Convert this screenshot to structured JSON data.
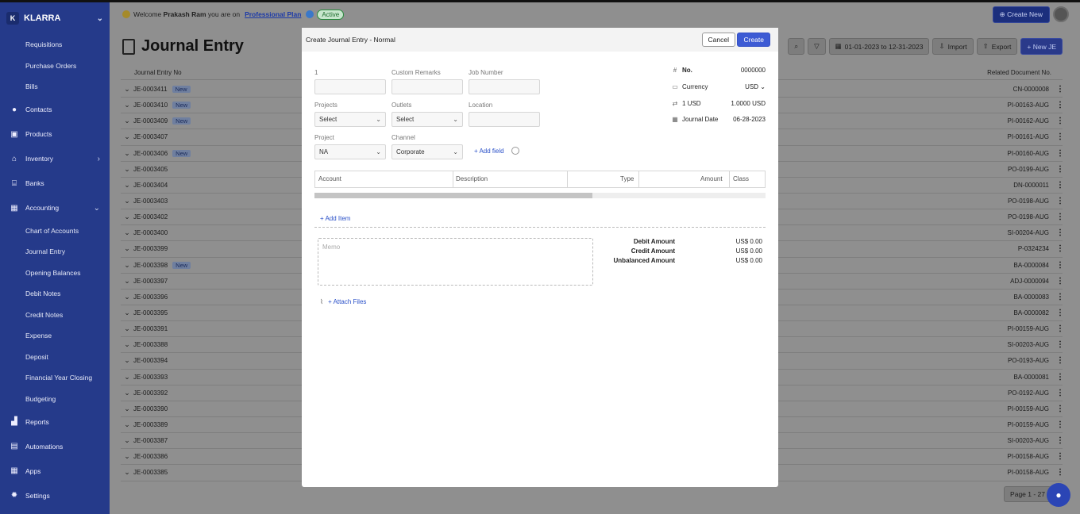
{
  "sidebar": {
    "brand_initial": "K",
    "brand": "KLARRA",
    "items": [
      {
        "type": "sub",
        "label": "Requisitions"
      },
      {
        "type": "sub",
        "label": "Purchase Orders"
      },
      {
        "type": "sub",
        "label": "Bills"
      },
      {
        "type": "main",
        "label": "Contacts",
        "icon": "user-icon"
      },
      {
        "type": "main",
        "label": "Products",
        "icon": "box-icon"
      },
      {
        "type": "main",
        "label": "Inventory",
        "icon": "home-icon",
        "chevron": "›"
      },
      {
        "type": "main",
        "label": "Banks",
        "icon": "bank-icon"
      },
      {
        "type": "main",
        "label": "Accounting",
        "icon": "grid-icon",
        "chevron": "⌄"
      },
      {
        "type": "sub",
        "label": "Chart of Accounts"
      },
      {
        "type": "sub",
        "label": "Journal Entry"
      },
      {
        "type": "sub",
        "label": "Opening Balances"
      },
      {
        "type": "sub",
        "label": "Debit Notes"
      },
      {
        "type": "sub",
        "label": "Credit Notes"
      },
      {
        "type": "sub",
        "label": "Expense"
      },
      {
        "type": "sub",
        "label": "Deposit"
      },
      {
        "type": "sub",
        "label": "Financial Year Closing"
      },
      {
        "type": "sub",
        "label": "Budgeting"
      },
      {
        "type": "main",
        "label": "Reports",
        "icon": "chart-icon"
      },
      {
        "type": "main",
        "label": "Automations",
        "icon": "robot-icon"
      },
      {
        "type": "main",
        "label": "Apps",
        "icon": "apps-icon"
      },
      {
        "type": "main",
        "label": "Settings",
        "icon": "gear-icon"
      }
    ]
  },
  "topbar": {
    "welcome": "Welcome",
    "user": "Prakash Ram",
    "you_are_on": "you are on",
    "plan": "Professional Plan",
    "status": "Active",
    "create_new": "Create New"
  },
  "page": {
    "title": "Journal Entry",
    "date_range": "01-01-2023 to 12-31-2023",
    "import": "Import",
    "export": "Export",
    "new_je": "+ New JE",
    "col_no": "Journal Entry No",
    "col_related": "Related Document No.",
    "pager": "Page 1 - 27"
  },
  "rows": [
    {
      "no": "JE-0003411",
      "new": "New",
      "rel": "CN-0000008"
    },
    {
      "no": "JE-0003410",
      "new": "New",
      "rel": "PI-00163-AUG"
    },
    {
      "no": "JE-0003409",
      "new": "New",
      "rel": "PI-00162-AUG"
    },
    {
      "no": "JE-0003407",
      "new": "",
      "rel": "PI-00161-AUG"
    },
    {
      "no": "JE-0003406",
      "new": "New",
      "rel": "PI-00160-AUG"
    },
    {
      "no": "JE-0003405",
      "new": "",
      "rel": "PO-0199-AUG"
    },
    {
      "no": "JE-0003404",
      "new": "",
      "rel": "DN-0000011"
    },
    {
      "no": "JE-0003403",
      "new": "",
      "rel": "PO-0198-AUG"
    },
    {
      "no": "JE-0003402",
      "new": "",
      "rel": "PO-0198-AUG"
    },
    {
      "no": "JE-0003400",
      "new": "",
      "rel": "SI-00204-AUG"
    },
    {
      "no": "JE-0003399",
      "new": "",
      "rel": "P-0324234"
    },
    {
      "no": "JE-0003398",
      "new": "New",
      "rel": "BA-0000084"
    },
    {
      "no": "JE-0003397",
      "new": "",
      "rel": "ADJ-0000094"
    },
    {
      "no": "JE-0003396",
      "new": "",
      "rel": "BA-0000083"
    },
    {
      "no": "JE-0003395",
      "new": "",
      "rel": "BA-0000082"
    },
    {
      "no": "JE-0003391",
      "new": "",
      "rel": "PI-00159-AUG"
    },
    {
      "no": "JE-0003388",
      "new": "",
      "rel": "SI-00203-AUG"
    },
    {
      "no": "JE-0003394",
      "new": "",
      "rel": "PO-0193-AUG"
    },
    {
      "no": "JE-0003393",
      "new": "",
      "rel": "BA-0000081"
    },
    {
      "no": "JE-0003392",
      "new": "",
      "rel": "PO-0192-AUG"
    },
    {
      "no": "JE-0003390",
      "new": "",
      "rel": "PI-00159-AUG"
    },
    {
      "no": "JE-0003389",
      "new": "",
      "rel": "PI-00159-AUG"
    },
    {
      "no": "JE-0003387",
      "new": "",
      "rel": "SI-00203-AUG"
    },
    {
      "no": "JE-0003386",
      "new": "",
      "rel": "PI-00158-AUG"
    },
    {
      "no": "JE-0003385",
      "new": "",
      "rel": "PI-00158-AUG"
    }
  ],
  "modal": {
    "title": "Create Journal Entry - Normal",
    "cancel": "Cancel",
    "create": "Create",
    "fields": {
      "f1_label": "1",
      "remarks_label": "Custom Remarks",
      "job_label": "Job Number",
      "projects_label": "Projects",
      "projects_value": "Select",
      "outlets_label": "Outlets",
      "outlets_value": "Select",
      "location_label": "Location",
      "project_label": "Project",
      "project_value": "NA",
      "channel_label": "Channel",
      "channel_value": "Corporate",
      "add_field": "+ Add field"
    },
    "info": {
      "no_label": "No.",
      "no_value": "0000000",
      "currency_label": "Currency",
      "currency_value": "USD",
      "rate_label": "1 USD",
      "rate_value": "1.0000 USD",
      "date_label": "Journal Date",
      "date_value": "06-28-2023"
    },
    "grid": {
      "account": "Account",
      "description": "Description",
      "type": "Type",
      "amount": "Amount",
      "class": "Class"
    },
    "add_item": "+ Add Item",
    "memo_placeholder": "Memo",
    "totals": [
      {
        "label": "Debit Amount",
        "value": "US$ 0.00"
      },
      {
        "label": "Credit Amount",
        "value": "US$ 0.00"
      },
      {
        "label": "Unbalanced Amount",
        "value": "US$ 0.00"
      }
    ],
    "attach": "+ Attach Files"
  }
}
